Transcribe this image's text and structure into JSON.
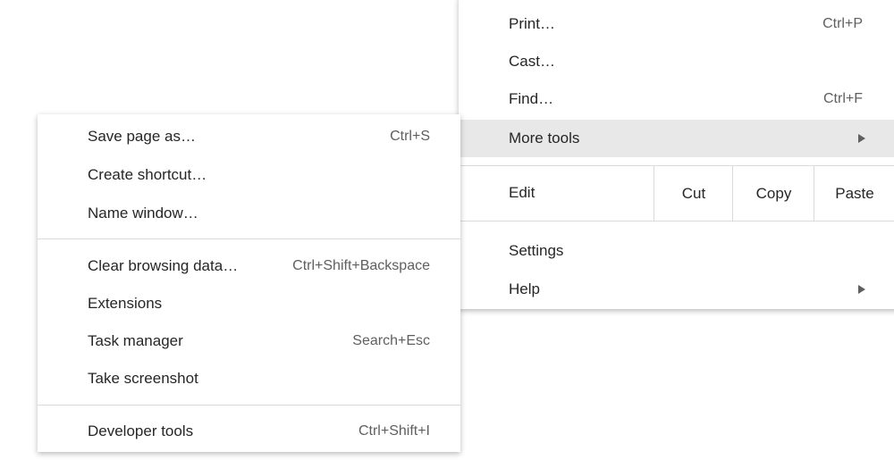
{
  "main_menu": {
    "items": [
      {
        "label": "Print…",
        "shortcut": "Ctrl+P"
      },
      {
        "label": "Cast…"
      },
      {
        "label": "Find…",
        "shortcut": "Ctrl+F"
      },
      {
        "label": "More tools",
        "submenu": true,
        "highlighted": true
      }
    ],
    "edit": {
      "label": "Edit",
      "cut": "Cut",
      "copy": "Copy",
      "paste": "Paste"
    },
    "settings": "Settings",
    "help": "Help"
  },
  "more_tools_submenu": {
    "items": [
      {
        "label": "Save page as…",
        "shortcut": "Ctrl+S"
      },
      {
        "label": "Create shortcut…"
      },
      {
        "label": "Name window…"
      },
      {
        "label": "Clear browsing data…",
        "shortcut": "Ctrl+Shift+Backspace"
      },
      {
        "label": "Extensions"
      },
      {
        "label": "Task manager",
        "shortcut": "Search+Esc"
      },
      {
        "label": "Take screenshot"
      },
      {
        "label": "Developer tools",
        "shortcut": "Ctrl+Shift+I"
      }
    ]
  },
  "colors": {
    "highlight": "#e8e8e8",
    "separator": "#dadada",
    "text": "#262626",
    "shortcut": "#5f5f5f"
  }
}
